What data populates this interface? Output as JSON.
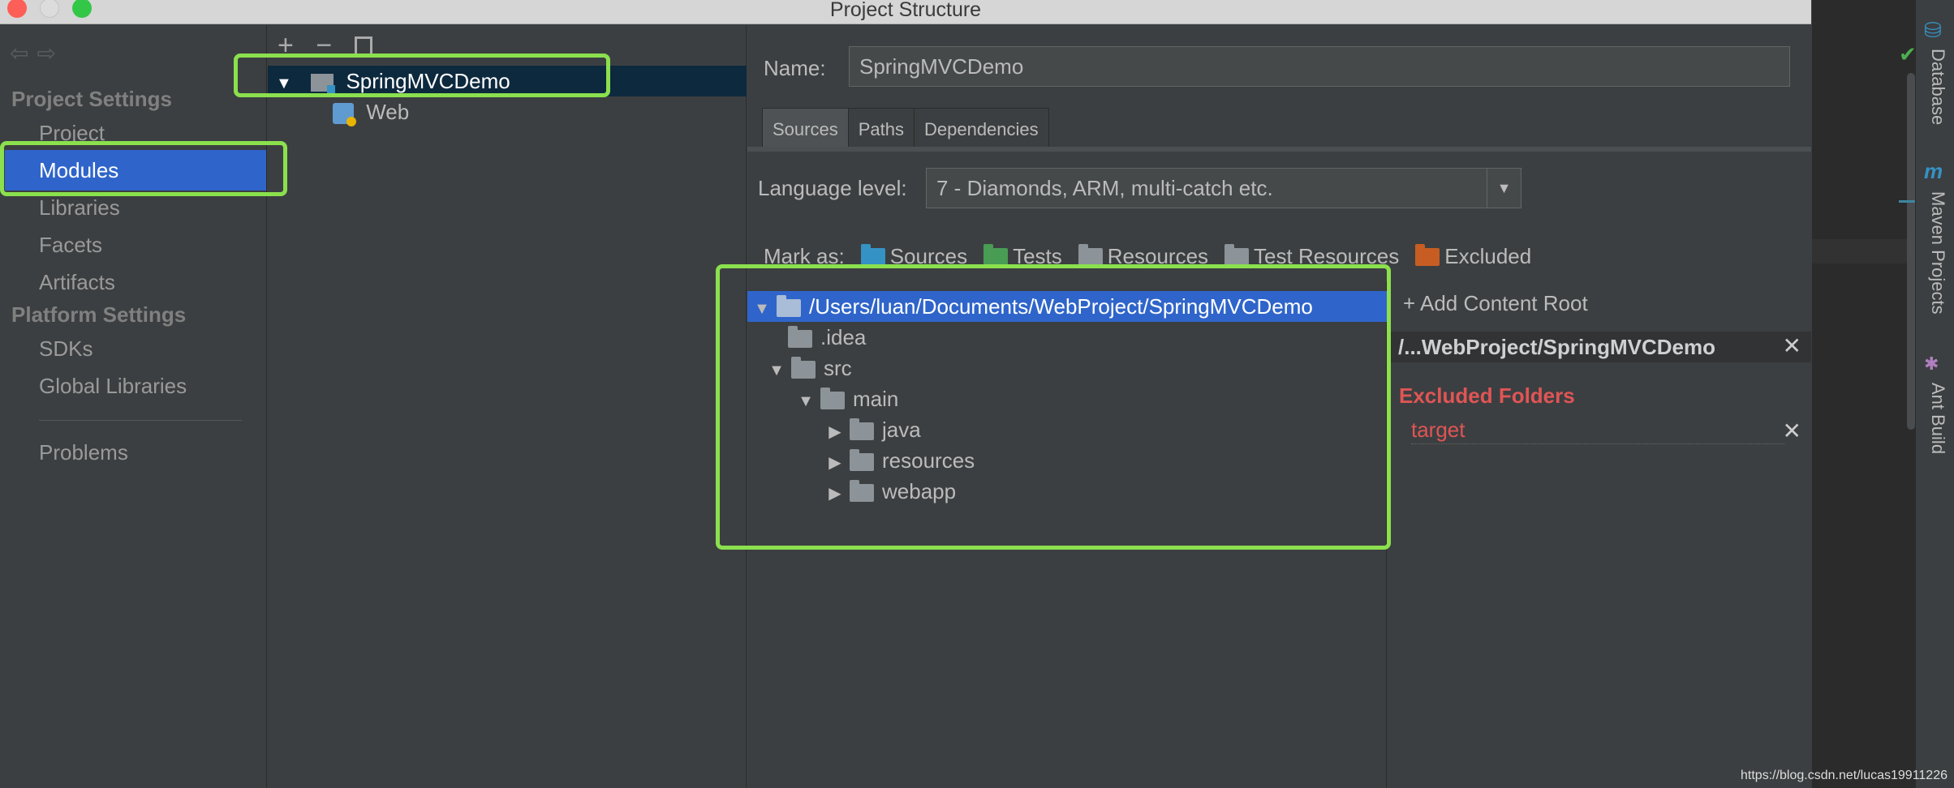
{
  "window": {
    "title": "Project Structure"
  },
  "nav": {
    "project_settings_heading": "Project Settings",
    "platform_settings_heading": "Platform Settings",
    "items": {
      "project": "Project",
      "modules": "Modules",
      "libraries": "Libraries",
      "facets": "Facets",
      "artifacts": "Artifacts",
      "sdks": "SDKs",
      "global_libraries": "Global Libraries",
      "problems": "Problems"
    }
  },
  "modules_tree": {
    "toolbar": {
      "add": "+",
      "remove": "−"
    },
    "root": "SpringMVCDemo",
    "child": "Web"
  },
  "module": {
    "name_label": "Name:",
    "name_value": "SpringMVCDemo",
    "tabs": [
      "Sources",
      "Paths",
      "Dependencies"
    ],
    "language_level_label": "Language level:",
    "language_level_value": "7 - Diamonds, ARM, multi-catch etc.",
    "mark_as_label": "Mark as:",
    "mark_as": [
      {
        "label": "Sources",
        "color": "#3592c4"
      },
      {
        "label": "Tests",
        "color": "#499c54"
      },
      {
        "label": "Resources",
        "color": "#8c9399"
      },
      {
        "label": "Test Resources",
        "color": "#8c9399"
      },
      {
        "label": "Excluded",
        "color": "#c75d22"
      }
    ]
  },
  "dir_tree": [
    {
      "label": "/Users/luan/Documents/WebProject/SpringMVCDemo",
      "expanded": true,
      "selected": true
    },
    {
      "label": ".idea"
    },
    {
      "label": "src",
      "expanded": true
    },
    {
      "label": "main",
      "expanded": true
    },
    {
      "label": "java",
      "collapsed": true
    },
    {
      "label": "resources",
      "collapsed": true
    },
    {
      "label": "webapp",
      "collapsed": true
    }
  ],
  "content_root": {
    "add_label": "+ Add Content Root",
    "path": "/...WebProject/SpringMVCDemo",
    "excluded_heading": "Excluded Folders",
    "excluded": [
      "target"
    ]
  },
  "right_sidebar": {
    "tabs": [
      "Database",
      "Maven Projects",
      "Ant Build"
    ]
  },
  "watermark": "https://blog.csdn.net/lucas19911226",
  "colors": {
    "selection": "#2f65ca",
    "highlight_box": "#8be04e",
    "excluded_text": "#e05555"
  }
}
